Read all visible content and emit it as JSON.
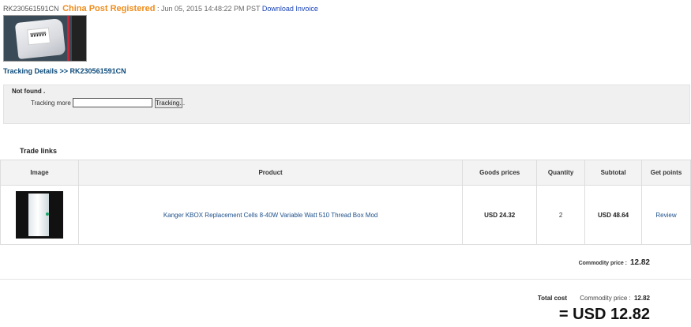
{
  "header": {
    "tracking_number": "RK230561591CN",
    "carrier": "China Post Registered",
    "date": ": Jun 05, 2015 14:48:22 PM PST",
    "download_invoice": "Download Invoice"
  },
  "tracking": {
    "title": "Tracking Details >> RK230561591CN",
    "not_found": "Not found .",
    "more_label": "Tracking more :",
    "input_value": "",
    "button": "Tracking..."
  },
  "trade": {
    "title": "Trade links",
    "columns": [
      "Image",
      "Product",
      "Goods prices",
      "Quantity",
      "Subtotal",
      "Get points"
    ],
    "rows": [
      {
        "product": "Kanger KBOX Replacement Cells 8-40W Variable Watt 510 Thread Box Mod",
        "price": "USD 24.32",
        "quantity": "2",
        "subtotal": "USD 48.64",
        "points": "Review"
      }
    ]
  },
  "summary": {
    "commodity_label": "Commodity price :",
    "commodity_value": "12.82",
    "total_label": "Total cost",
    "total_commodity_label": "Commodity price :",
    "total_commodity_value": "12.82",
    "grand_total": "= USD 12.82"
  },
  "colors": {
    "carrier": "#f08c1a",
    "link": "#1a44b8",
    "heading": "#0b4a7a"
  }
}
